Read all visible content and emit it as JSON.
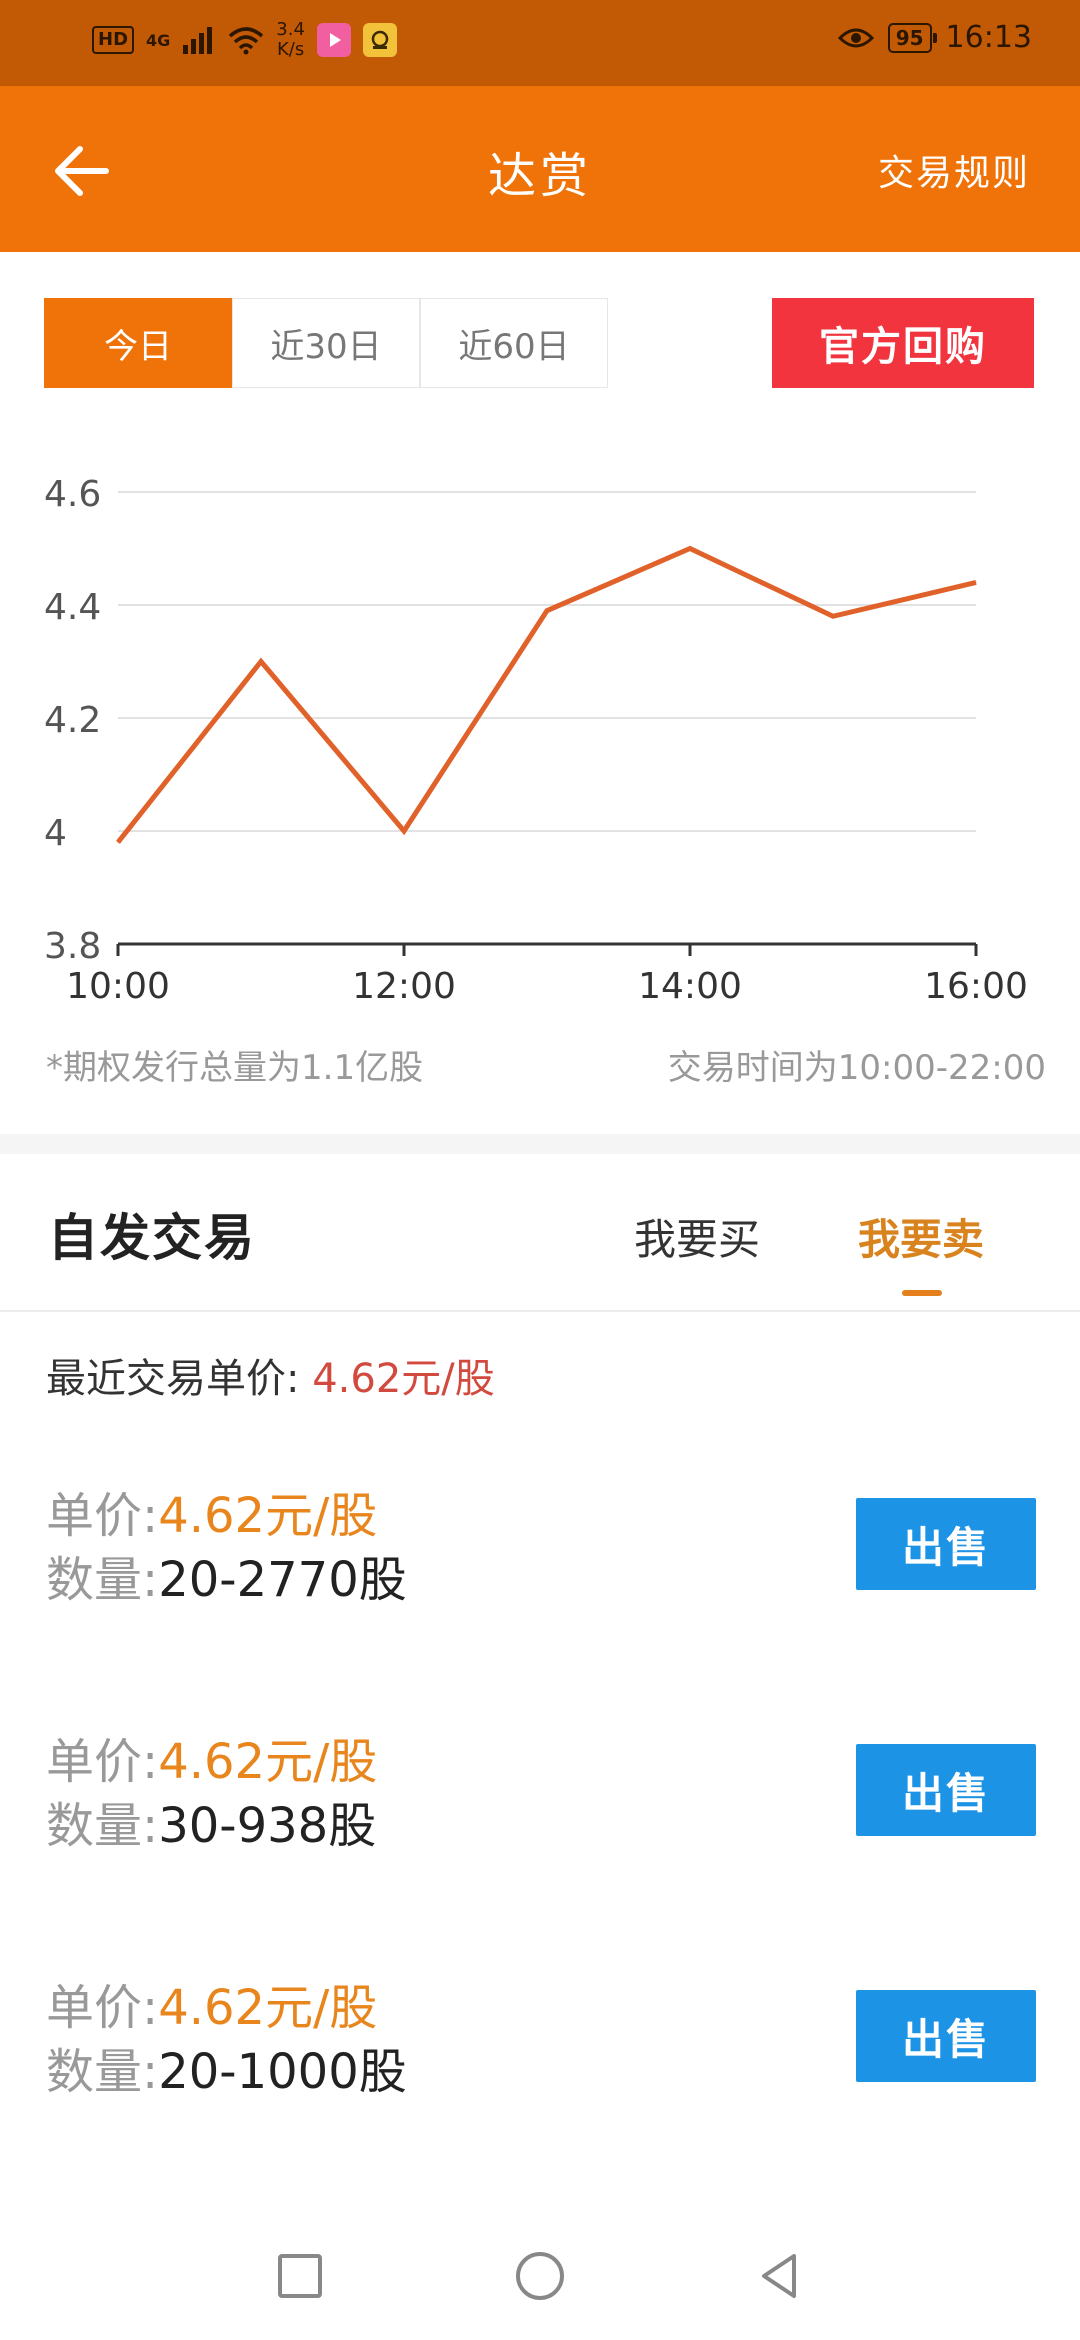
{
  "status_bar": {
    "hd": "HD",
    "network": "4G",
    "speed_top": "3.4",
    "speed_bottom": "K/s",
    "battery": "95",
    "time": "16:13"
  },
  "header": {
    "title": "达赏",
    "rules": "交易规则"
  },
  "period_tabs": [
    {
      "label": "今日",
      "active": true
    },
    {
      "label": "近30日",
      "active": false
    },
    {
      "label": "近60日",
      "active": false
    }
  ],
  "buyback_label": "官方回购",
  "chart_data": {
    "type": "line",
    "x": [
      "10:00",
      "11:00",
      "12:00",
      "13:00",
      "14:00",
      "15:00",
      "16:00"
    ],
    "values": [
      3.98,
      4.3,
      4.0,
      4.39,
      4.5,
      4.38,
      4.44
    ],
    "x_ticks": [
      "10:00",
      "12:00",
      "14:00",
      "16:00"
    ],
    "y_ticks": [
      "3.8",
      "4",
      "4.2",
      "4.4",
      "4.6"
    ],
    "ylim": [
      3.8,
      4.6
    ],
    "grid": true,
    "line_color": "#e0622a",
    "title": "",
    "xlabel": "",
    "ylabel": ""
  },
  "notes": {
    "left": "*期权发行总量为1.1亿股",
    "right": "交易时间为10:00-22:00"
  },
  "trade": {
    "title": "自发交易",
    "tab_buy": "我要买",
    "tab_sell": "我要卖",
    "recent_label": "最近交易单价:",
    "recent_price": "4.62元/股",
    "listings": [
      {
        "price_label": "单价:",
        "price": "4.62元/股",
        "qty_label": "数量:",
        "qty": "20-2770股",
        "button": "出售"
      },
      {
        "price_label": "单价:",
        "price": "4.62元/股",
        "qty_label": "数量:",
        "qty": "30-938股",
        "button": "出售"
      },
      {
        "price_label": "单价:",
        "price": "4.62元/股",
        "qty_label": "数量:",
        "qty": "20-1000股",
        "button": "出售"
      }
    ]
  },
  "colors": {
    "accent": "#f07309",
    "buyback": "#f2343f",
    "sell_button": "#1d93e6",
    "price": "#e8861d"
  }
}
